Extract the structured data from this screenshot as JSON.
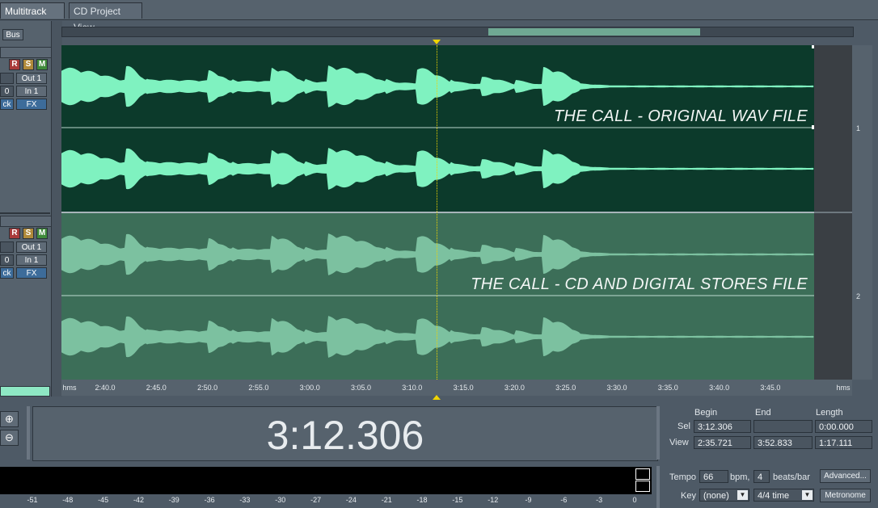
{
  "tabs": [
    "Multitrack View",
    "CD Project View"
  ],
  "bus_button": "Bus",
  "tracks": [
    {
      "r": "R",
      "s": "S",
      "m": "M",
      "vol": "0",
      "out": "Out 1",
      "in": "In 1",
      "lock": "ck",
      "fx": "FX",
      "label": "THE CALL - ORIGINAL WAV FILE",
      "number": "1"
    },
    {
      "r": "R",
      "s": "S",
      "m": "M",
      "vol": "0",
      "out": "Out 1",
      "in": "In 1",
      "lock": "ck",
      "fx": "FX",
      "label": "THE CALL - CD AND DIGITAL STORES FILE",
      "number": "2"
    }
  ],
  "ruler": {
    "start_label": "hms",
    "end_label": "hms",
    "ticks": [
      "2:40.0",
      "2:45.0",
      "2:50.0",
      "2:55.0",
      "3:00.0",
      "3:05.0",
      "3:10.0",
      "3:15.0",
      "3:20.0",
      "3:25.0",
      "3:30.0",
      "3:35.0",
      "3:40.0",
      "3:45.0"
    ]
  },
  "time_display": "3:12.306",
  "selection": {
    "headers": {
      "begin": "Begin",
      "end": "End",
      "length": "Length"
    },
    "sel_label": "Sel",
    "view_label": "View",
    "sel": {
      "begin": "3:12.306",
      "end": "",
      "length": "0:00.000"
    },
    "view": {
      "begin": "2:35.721",
      "end": "3:52.833",
      "length": "1:17.111"
    }
  },
  "tempo": {
    "tempo_label": "Tempo",
    "bpm": "66",
    "bpm_label": "bpm,",
    "beats": "4",
    "beats_label": "beats/bar",
    "advanced_button": "Advanced...",
    "key_label": "Key",
    "key_value": "(none)",
    "time_sig": "4/4 time",
    "metronome_button": "Metronome"
  },
  "meter_scale": [
    "-51",
    "-48",
    "-45",
    "-42",
    "-39",
    "-36",
    "-33",
    "-30",
    "-27",
    "-24",
    "-21",
    "-18",
    "-15",
    "-12",
    "-9",
    "-6",
    "-3",
    "0"
  ],
  "colors": {
    "wave_bright": "#7ff2c0",
    "wave_dim": "#7cc1a0",
    "track1_bg": "#0f3a2c",
    "track2_bg": "#3c6e58",
    "accent": "#f0d400"
  }
}
